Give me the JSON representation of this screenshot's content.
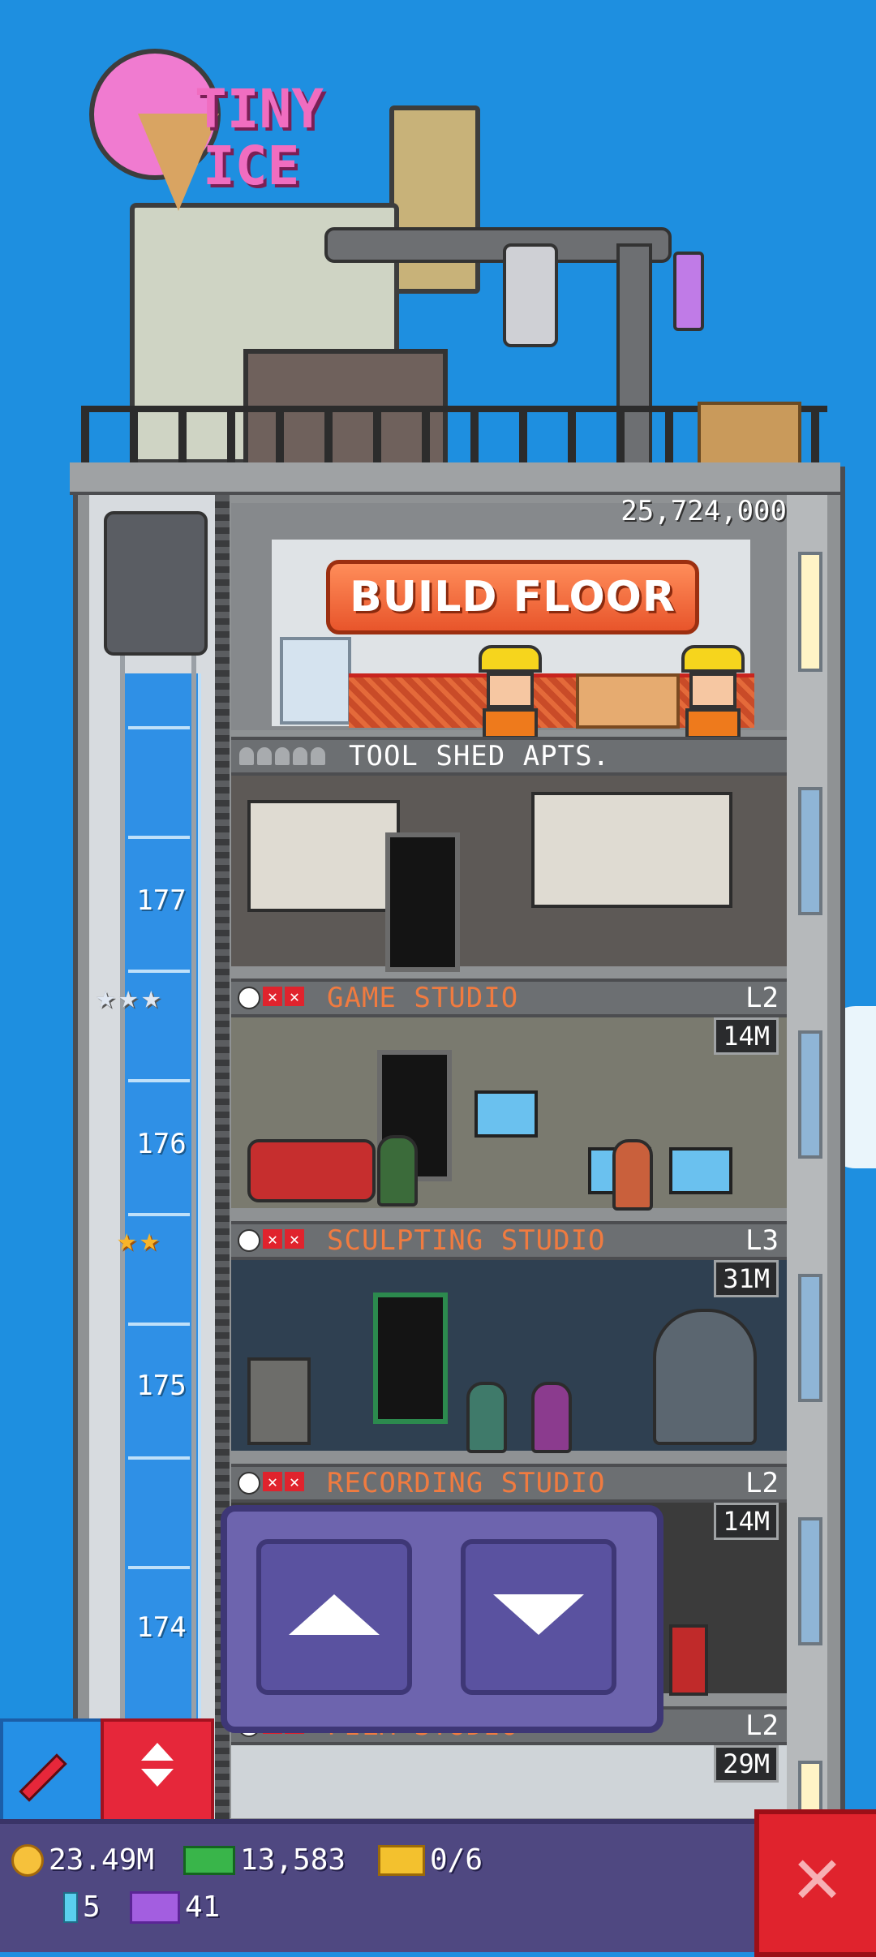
{
  "logo": {
    "line1": "TINY",
    "line2": "ICE"
  },
  "build_floor": {
    "budget": "25,724,000",
    "button_label": "BUILD FLOOR"
  },
  "floors": [
    {
      "name": "TOOL SHED APTS.",
      "type": "residential"
    },
    {
      "name": "GAME STUDIO",
      "type": "business",
      "level": "L2",
      "cost": "14M",
      "elevator_floor": "177"
    },
    {
      "name": "SCULPTING STUDIO",
      "type": "business",
      "level": "L3",
      "cost": "31M",
      "elevator_floor": "176"
    },
    {
      "name": "RECORDING STUDIO",
      "type": "business",
      "level": "L2",
      "cost": "14M",
      "elevator_floor": "175"
    },
    {
      "name": "FILM STUDIO",
      "type": "business",
      "level": "L2",
      "cost": "29M",
      "elevator_floor": "174"
    }
  ],
  "hud": {
    "coins": "23.49M",
    "bux": "13,583",
    "vip": "0/6",
    "keys": "5",
    "tickets": "41"
  },
  "colors": {
    "sky": "#1e8fe0",
    "business_text": "#f07b40",
    "build_button": "#e8552b",
    "hud_bg": "#4f4881",
    "close_button": "#e0232d"
  },
  "icons": [
    "clock-icon",
    "close-icon",
    "star-icon",
    "coin-icon",
    "bux-icon",
    "vip-icon",
    "key-icon",
    "ticket-icon",
    "arrow-up-icon",
    "arrow-down-icon",
    "pencil-icon"
  ]
}
